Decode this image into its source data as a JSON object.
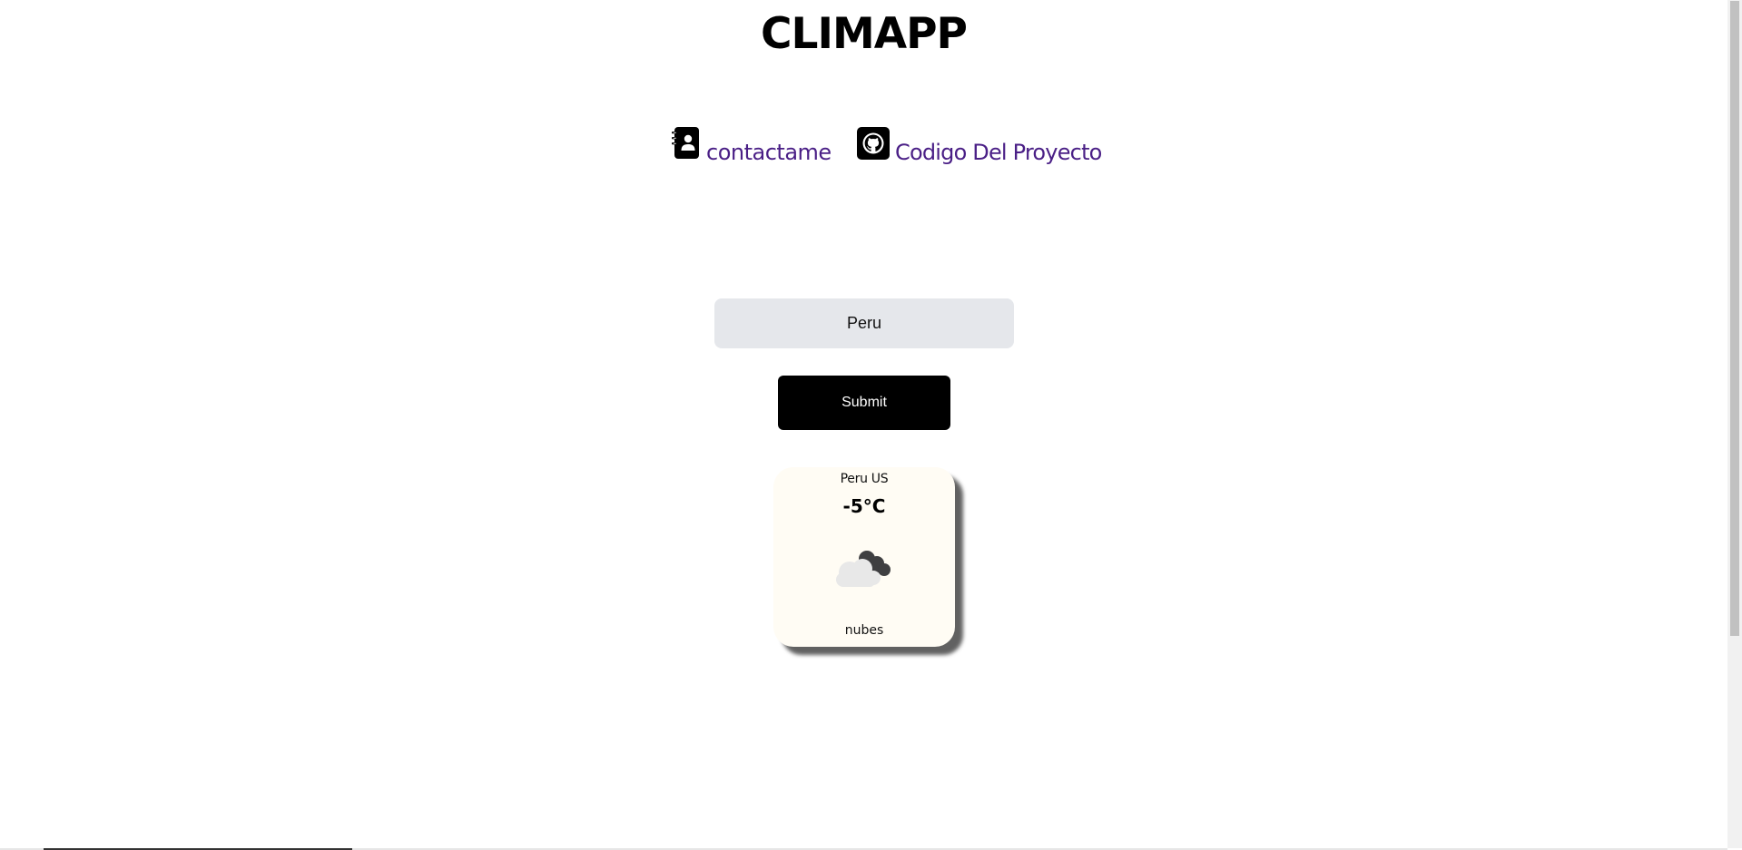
{
  "app": {
    "title": "CLIMAPP"
  },
  "nav": {
    "contact": {
      "label": "contactame",
      "icon": "address-book-icon"
    },
    "repo": {
      "label": "Codigo Del Proyecto",
      "icon": "github-icon"
    }
  },
  "search": {
    "value": "Peru",
    "placeholder": ""
  },
  "form": {
    "submit_label": "Submit"
  },
  "weather": {
    "location": "Peru US",
    "temperature": "-5°C",
    "description": "nubes",
    "icon": "cloud-icon"
  },
  "colors": {
    "link": "#4a1f86",
    "input_bg": "#e5e7eb",
    "button_bg": "#000000",
    "card_bg": "#fffcf4"
  }
}
